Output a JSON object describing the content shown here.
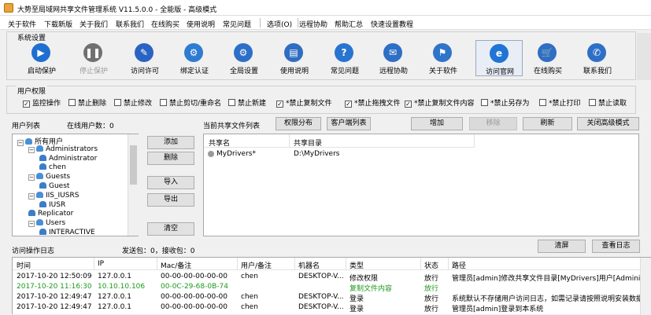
{
  "window": {
    "title": "大势至局域网共享文件管理系统 V11.5.0.0 - 全能版 - 高级模式"
  },
  "menu": [
    "关于软件",
    "下载新版",
    "关于我们",
    "联系我们",
    "在线购买",
    "使用说明",
    "常见问题",
    "选项(O)",
    "远程协助",
    "帮助汇总",
    "快速设置教程"
  ],
  "system_settings": {
    "label": "系统设置",
    "buttons": [
      {
        "label": "启动保护",
        "icon": "play-icon",
        "color": "#1f6fd1",
        "glyph": "▶"
      },
      {
        "label": "停止保护",
        "icon": "pause-icon",
        "color": "#707070",
        "glyph": "❚❚"
      },
      {
        "label": "访问许可",
        "icon": "key-icon",
        "color": "#2a64c2",
        "glyph": "✎"
      },
      {
        "label": "绑定认证",
        "icon": "gear-icon",
        "color": "#2e7bd2",
        "glyph": "⚙"
      },
      {
        "label": "全局设置",
        "icon": "settings-icon",
        "color": "#2b6fc8",
        "glyph": "⚙"
      },
      {
        "label": "使用说明",
        "icon": "book-icon",
        "color": "#2f6dc1",
        "glyph": "▤"
      },
      {
        "label": "常见问题",
        "icon": "question-icon",
        "color": "#2874d0",
        "glyph": "?"
      },
      {
        "label": "远程协助",
        "icon": "remote-assist-icon",
        "color": "#2d6fc6",
        "glyph": "✉"
      },
      {
        "label": "关于软件",
        "icon": "about-icon",
        "color": "#2e74c9",
        "glyph": "⚑"
      },
      {
        "label": "访问官网",
        "icon": "ie-browser-icon",
        "color": "#1f74d6",
        "glyph": "e"
      },
      {
        "label": "在线购买",
        "icon": "cart-icon",
        "color": "#2f6ec4",
        "glyph": "🛒"
      },
      {
        "label": "联系我们",
        "icon": "contact-icon",
        "color": "#2e6fc6",
        "glyph": "✆"
      }
    ]
  },
  "permissions": {
    "label": "用户权限",
    "items": [
      {
        "label": "监控操作",
        "checked": "✓"
      },
      {
        "label": "禁止删除",
        "checked": ""
      },
      {
        "label": "禁止修改",
        "checked": ""
      },
      {
        "label": "禁止剪切/重命名",
        "checked": ""
      },
      {
        "label": "禁止新建",
        "checked": ""
      },
      {
        "label": "*禁止复制文件",
        "checked": "✓"
      },
      {
        "label": "*禁止拖拽文件",
        "checked": "✓"
      },
      {
        "label": "*禁止复制文件内容",
        "checked": "✓"
      },
      {
        "label": "*禁止另存为",
        "checked": ""
      },
      {
        "label": "*禁止打印",
        "checked": ""
      },
      {
        "label": "禁止读取",
        "checked": ""
      }
    ]
  },
  "user_list": {
    "label": "用户列表",
    "online_label": "在线用户数：0",
    "tree": [
      {
        "text": "所有用户",
        "toggle": "−"
      },
      {
        "text": "Administrators",
        "toggle": "−"
      },
      {
        "text": "Administrator",
        "toggle": ""
      },
      {
        "text": "chen",
        "toggle": ""
      },
      {
        "text": "Guests",
        "toggle": "−"
      },
      {
        "text": "Guest",
        "toggle": ""
      },
      {
        "text": "IIS_IUSRS",
        "toggle": "−"
      },
      {
        "text": "IUSR",
        "toggle": ""
      },
      {
        "text": "Replicator",
        "toggle": ""
      },
      {
        "text": "Users",
        "toggle": "−"
      },
      {
        "text": "INTERACTIVE",
        "toggle": ""
      }
    ],
    "buttons": [
      "添加",
      "删除",
      "导入",
      "导出",
      "清空"
    ]
  },
  "shares": {
    "label": "当前共享文件列表",
    "buttons": [
      "权限分布",
      "客户端列表",
      "增加",
      "移除",
      "刷新",
      "关闭高级模式"
    ],
    "columns": [
      "共享名",
      "共享目录"
    ],
    "rows": [
      {
        "name": "MyDrivers*",
        "path": "D:\\MyDrivers"
      }
    ]
  },
  "log": {
    "label": "访问操作日志",
    "counts": "发送包：0，接收包：0",
    "buttons": [
      "清屏",
      "查看日志"
    ],
    "columns": [
      "时间",
      "IP",
      "Mac/备注",
      "用户/备注",
      "机器名",
      "类型",
      "状态",
      "路径"
    ],
    "rows": [
      {
        "time": "2017-10-20 12:50:09",
        "ip": "127.0.0.1",
        "mac": "00-00-00-00-00-00",
        "user": "chen",
        "machine": "DESKTOP-V...",
        "type": "修改权限",
        "status": "放行",
        "path": "管理员[admin]修改共享文件目录[MyDrivers]用户[Administrator",
        "color": "#000000"
      },
      {
        "time": "2017-10-20 11:16:30",
        "ip": "10.10.10.106",
        "mac": "00-0C-29-68-0B-74",
        "user": "",
        "machine": "",
        "type": "复制文件内容",
        "status": "放行",
        "path": "",
        "color": "#1c9a1c"
      },
      {
        "time": "2017-10-20 12:49:47",
        "ip": "127.0.0.1",
        "mac": "00-00-00-00-00-00",
        "user": "chen",
        "machine": "DESKTOP-V...",
        "type": "登录",
        "status": "放行",
        "path": "系统默认不存储用户访问日志，如需记录请按照说明安装数据库",
        "color": "#000000"
      },
      {
        "time": "2017-10-20 12:49:47",
        "ip": "127.0.0.1",
        "mac": "00-00-00-00-00-00",
        "user": "chen",
        "machine": "DESKTOP-V...",
        "type": "登录",
        "status": "放行",
        "path": "管理员[admin]登录到本系统",
        "color": "#000000"
      }
    ]
  }
}
